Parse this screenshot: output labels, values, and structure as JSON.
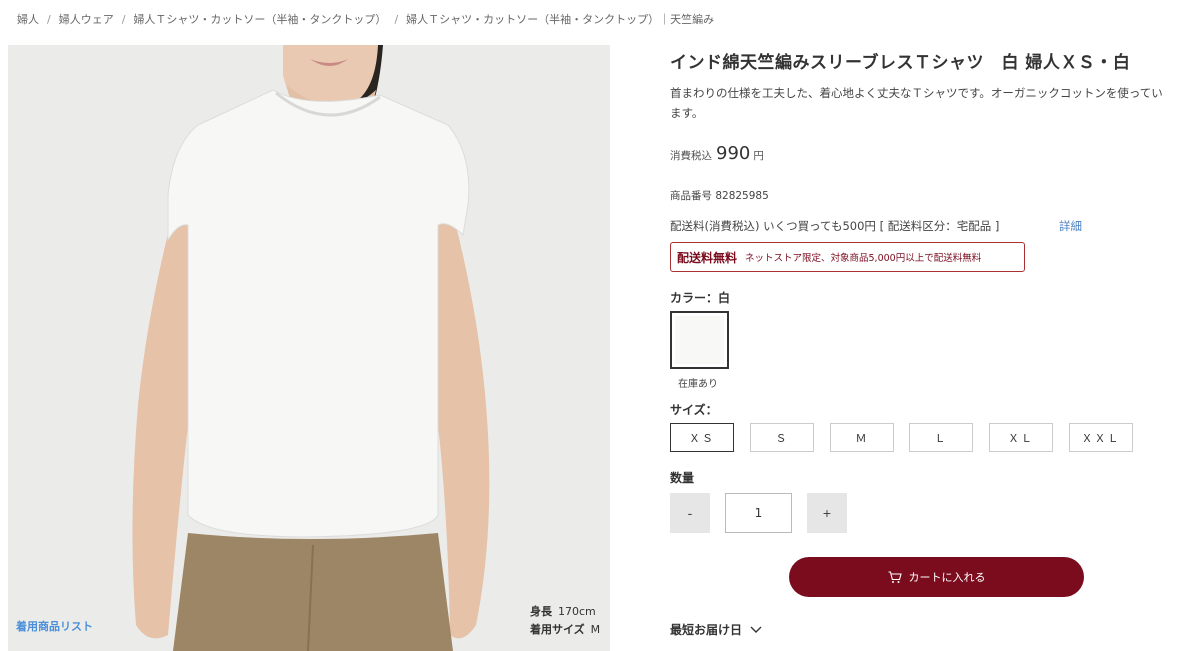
{
  "breadcrumb": [
    "婦人",
    "婦人ウェア",
    "婦人Ｔシャツ・カットソー（半袖・タンクトップ）",
    "婦人Ｔシャツ・カットソー（半袖・タンクトップ）｜天竺編み"
  ],
  "photo": {
    "model_list_link": "着用商品リスト",
    "height_label": "身長",
    "height_value": "170cm",
    "size_label": "着用サイズ",
    "size_value": "M"
  },
  "product": {
    "title": "インド綿天竺編みスリーブレスＴシャツ　白 婦人ＸＳ・白",
    "description": "首まわりの仕様を工夫した、着心地よく丈夫なＴシャツです。オーガニックコットンを使っています。",
    "price_label": "消費税込",
    "price": "990",
    "price_unit": "円",
    "product_number": "商品番号 82825985",
    "shipping_text": "配送料(消費税込)  いくつ買っても500円 [ 配送料区分：宅配品 ]",
    "shipping_detail_link": "詳細",
    "free_shipping_title": "配送料無料",
    "free_shipping_note": "ネットストア限定、対象商品5,000円以上で配送料無料"
  },
  "color": {
    "label": "カラー：白",
    "swatch_color": "#f8f8f6",
    "stock": "在庫あり"
  },
  "size": {
    "label": "サイズ：",
    "options": [
      "ＸＳ",
      "Ｓ",
      "Ｍ",
      "Ｌ",
      "ＸＬ",
      "ＸＸＬ"
    ],
    "selected": "ＸＳ"
  },
  "quantity": {
    "label": "数量",
    "minus": "-",
    "value": "1",
    "plus": "+"
  },
  "cart": {
    "label": "カートに入れる",
    "color": "#7b0c1e"
  },
  "delivery": {
    "label": "最短お届け日"
  }
}
